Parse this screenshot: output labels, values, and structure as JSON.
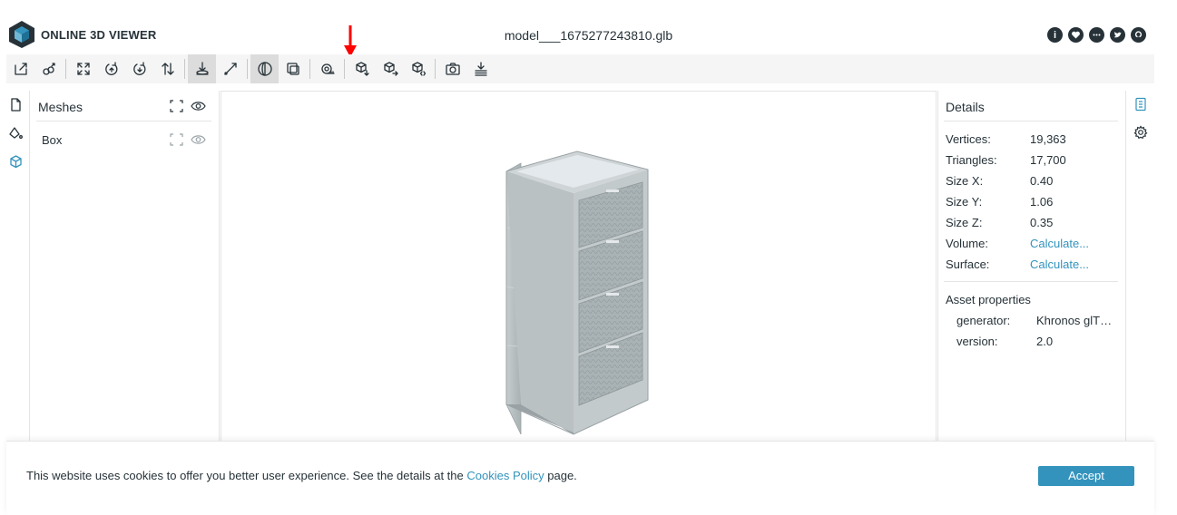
{
  "header": {
    "brand": "ONLINE 3D VIEWER",
    "file_name": "model___1675277243810.glb",
    "links": [
      {
        "icon": "info-icon"
      },
      {
        "icon": "heart-icon"
      },
      {
        "icon": "feedback-icon"
      },
      {
        "icon": "twitter-icon"
      },
      {
        "icon": "github-icon"
      }
    ]
  },
  "annotation": {
    "color": "#ff0000",
    "points_to": "measure-tool-button"
  },
  "toolbar": {
    "buttons": [
      "open-file",
      "open-url",
      "fit-to-window",
      "set-up-vector",
      "flip-up-vector",
      "swap-up-axis",
      "fixed-navigation",
      "free-orbit",
      "perspective-camera",
      "orthographic-camera",
      "measure-tool",
      "export-model",
      "share-model",
      "snapshot",
      "screenshot",
      "settings-floor"
    ]
  },
  "meshes": {
    "title": "Meshes",
    "items": [
      {
        "label": "Box"
      }
    ]
  },
  "details": {
    "title": "Details",
    "rows": [
      {
        "key": "Vertices:",
        "value": "19,363"
      },
      {
        "key": "Triangles:",
        "value": "17,700"
      },
      {
        "key": "Size X:",
        "value": "0.40"
      },
      {
        "key": "Size Y:",
        "value": "1.06"
      },
      {
        "key": "Size Z:",
        "value": "0.35"
      },
      {
        "key": "Volume:",
        "value": "Calculate..."
      },
      {
        "key": "Surface:",
        "value": "Calculate..."
      }
    ],
    "asset_title": "Asset properties",
    "asset_rows": [
      {
        "key": "generator:",
        "value": "Khronos glTF Blender I/O"
      },
      {
        "key": "version:",
        "value": "2.0"
      }
    ]
  },
  "cookie": {
    "text_before": "This website uses cookies to offer you better user experience. See the details at the ",
    "link": "Cookies Policy",
    "text_after": " page.",
    "accept_label": "Accept"
  },
  "colors": {
    "accent": "#3393bd",
    "text": "#263238",
    "toolbar_bg": "#f5f5f5",
    "model": "#b8c0c2"
  }
}
